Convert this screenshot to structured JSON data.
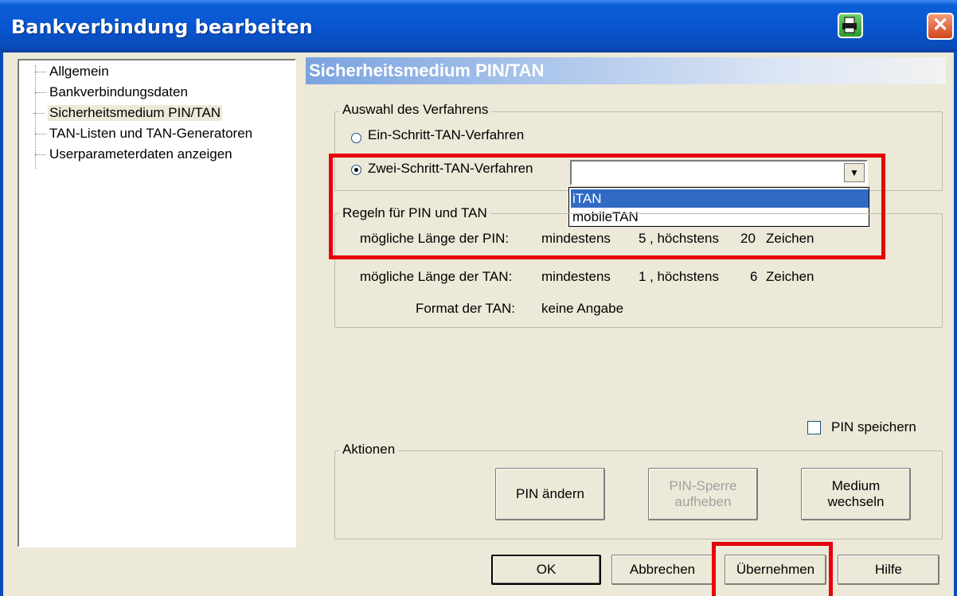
{
  "window": {
    "title": "Bankverbindung bearbeiten",
    "close_glyph": "✕"
  },
  "tree": {
    "items": [
      {
        "label": "Allgemein"
      },
      {
        "label": "Bankverbindungsdaten"
      },
      {
        "label": "Sicherheitsmedium PIN/TAN"
      },
      {
        "label": "TAN-Listen und TAN-Generatoren"
      },
      {
        "label": "Userparameterdaten anzeigen"
      }
    ],
    "selected_index": 2
  },
  "panel": {
    "title": "Sicherheitsmedium PIN/TAN",
    "verfahren": {
      "group_label": "Auswahl des Verfahrens",
      "option_one": "Ein-Schritt-TAN-Verfahren",
      "option_two": "Zwei-Schritt-TAN-Verfahren",
      "selected": "option_two",
      "combo_value": "",
      "dropdown_arrow": "▼",
      "dropdown_options": [
        "iTAN",
        "mobileTAN"
      ],
      "highlighted_option": "iTAN"
    },
    "regeln": {
      "group_label": "Regeln für PIN und TAN",
      "pin_label": "mögliche Länge der PIN:",
      "pin_min_label": "mindestens",
      "pin_min": "5",
      "pin_max_label": ", höchstens",
      "pin_max": "20",
      "pin_unit": "Zeichen",
      "tan_label": "mögliche Länge der TAN:",
      "tan_min_label": "mindestens",
      "tan_min": "1",
      "tan_max_label": ", höchstens",
      "tan_max": "6",
      "tan_unit": "Zeichen",
      "format_label": "Format der TAN:",
      "format_value": "keine Angabe"
    },
    "pin_speichern": {
      "label": "PIN speichern",
      "checked": false
    },
    "aktionen": {
      "group_label": "Aktionen",
      "pin_aendern": "PIN ändern",
      "pin_sperre_line1": "PIN-Sperre",
      "pin_sperre_line2": "aufheben",
      "medium_line1": "Medium",
      "medium_line2": "wechseln"
    }
  },
  "footer": {
    "ok": "OK",
    "abbrechen": "Abbrechen",
    "uebernehmen": "Übernehmen",
    "hilfe": "Hilfe"
  },
  "colors": {
    "titlebar": "#0854d0",
    "highlight_box": "#e6000b",
    "selection": "#316ac5"
  }
}
